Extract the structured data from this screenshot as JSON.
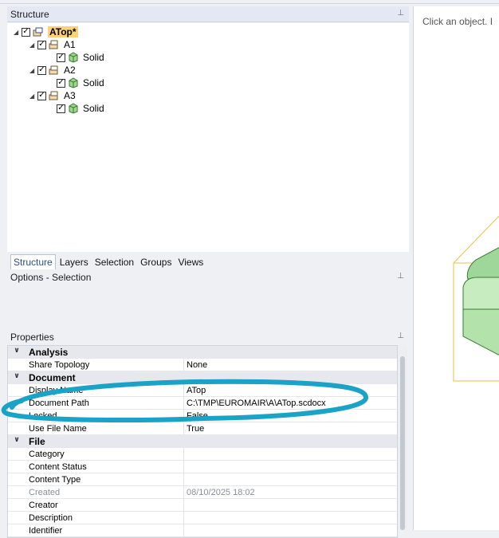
{
  "structure_panel": {
    "title": "Structure",
    "tree": [
      {
        "label": "ATop*",
        "expanded": true,
        "checked": true,
        "highlighted": true
      },
      {
        "label": "A1",
        "expanded": true,
        "checked": true
      },
      {
        "label": "Solid",
        "checked": true
      },
      {
        "label": "A2",
        "expanded": true,
        "checked": true
      },
      {
        "label": "Solid",
        "checked": true
      },
      {
        "label": "A3",
        "expanded": true,
        "checked": true
      },
      {
        "label": "Solid",
        "checked": true
      }
    ]
  },
  "tabs": [
    {
      "label": "Structure",
      "active": true
    },
    {
      "label": "Layers"
    },
    {
      "label": "Selection"
    },
    {
      "label": "Groups"
    },
    {
      "label": "Views"
    }
  ],
  "options_panel": {
    "title": "Options - Selection"
  },
  "properties_panel": {
    "title": "Properties",
    "groups": [
      {
        "name": "Analysis",
        "rows": [
          {
            "key": "Share Topology",
            "value": "None"
          }
        ]
      },
      {
        "name": "Document",
        "rows": [
          {
            "key": "Display Name",
            "value": "ATop"
          },
          {
            "key": "Document Path",
            "value": "C:\\TMP\\EUROMAIR\\A\\ATop.scdocx"
          },
          {
            "key": "Locked",
            "value": "False"
          },
          {
            "key": "Use File Name",
            "value": "True"
          }
        ]
      },
      {
        "name": "File",
        "rows": [
          {
            "key": "Category",
            "value": ""
          },
          {
            "key": "Content Status",
            "value": ""
          },
          {
            "key": "Content Type",
            "value": ""
          },
          {
            "key": "Created",
            "value": "08/10/2025 18:02",
            "dim": true
          },
          {
            "key": "Creator",
            "value": ""
          },
          {
            "key": "Description",
            "value": ""
          },
          {
            "key": "Identifier",
            "value": ""
          }
        ]
      }
    ]
  },
  "viewport": {
    "hint": "Click an object. I"
  },
  "colors": {
    "highlight": "#ffd27a",
    "annotation": "#1aa3c7",
    "solid_fill": "#bfe6b8",
    "bbox_line": "#e9c14a"
  },
  "icons": {
    "expand": "triangle-down-icon",
    "checkbox": "checkbox-checked-icon",
    "component": "component-icon",
    "solid": "solid-body-icon",
    "pin": "pin-icon"
  }
}
